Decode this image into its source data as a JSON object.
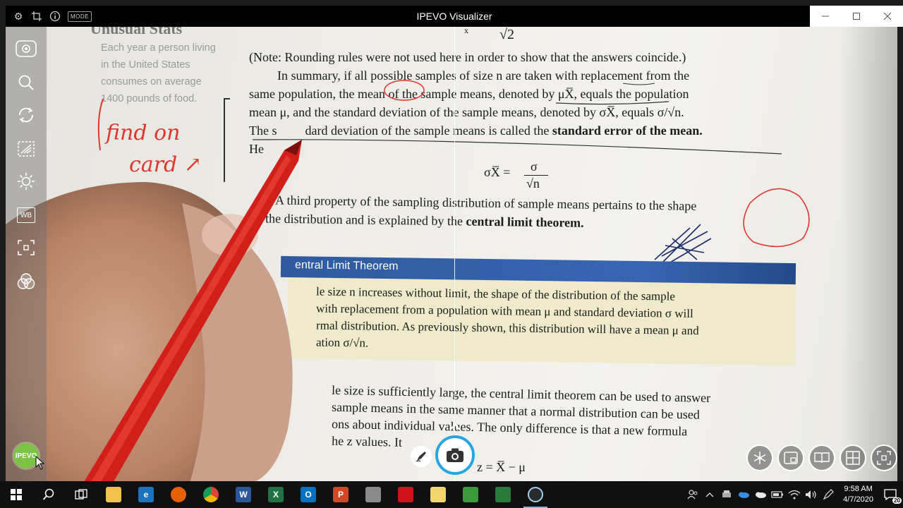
{
  "window": {
    "title": "IPEVO Visualizer",
    "mode_label": "MODE"
  },
  "camera": {
    "sidebar_heading": "Unusual Stats",
    "sidebar_note_lines": [
      "Each year a person living",
      "in the United States",
      "consumes on average",
      "1400 pounds of food."
    ],
    "handwriting_note": "find on card →",
    "paragraphs": {
      "note": "(Note: Rounding rules were not used here in order to show that the answers coincide.)",
      "summary_1": "In summary, if all possible samples of size n are taken with replacement from the",
      "summary_2": "same population, the mean of the sample means, denoted by μX̅, equals the population",
      "summary_3": "mean μ, and the standard deviation of the sample means, denoted by σX̅, equals σ/√n.",
      "summary_4a": "The s",
      "summary_4b": "dard deviation of the sample means is called the",
      "summary_4_bold": "standard error of the mean.",
      "summary_5": "He",
      "formula_top": "√2",
      "formula_std_error_left": "σX̅ =",
      "formula_std_error_num": "σ",
      "formula_std_error_den": "√n",
      "third_1": "A third property of the sampling distribution of sample means pertains to the shape",
      "third_2a": "the distribution and is explained by the",
      "third_2_bold": "central limit theorem.",
      "clt_header": "entral Limit Theorem",
      "clt_1": "le size n increases without limit, the shape of the distribution of the sample",
      "clt_2": "with replacement from a population with mean μ and standard deviation σ will",
      "clt_3": "rmal distribution. As previously shown, this distribution will have a mean μ and",
      "clt_4": "ation σ/√n.",
      "bottom_1": "le size is sufficiently large, the central limit theorem can be used to answer",
      "bottom_2": "sample means in the same manner that a normal distribution can be used",
      "bottom_3": "ons about individual values. The only difference is that a new formula",
      "bottom_4": "he z values. It",
      "bottom_formula": "z = X̅ − μ"
    }
  },
  "left_toolbar": {
    "items": [
      "record-icon",
      "zoom-icon",
      "rotate-icon",
      "mirror-icon",
      "brightness-icon",
      "whiteboard-icon",
      "autofocus-icon",
      "filter-icon"
    ],
    "wb_label": "WB",
    "logo_label": "IPEVO"
  },
  "bottom_controls": {
    "right_buttons": [
      "freeze-icon",
      "pip-icon",
      "book-icon",
      "grid-icon",
      "fullscreen-icon"
    ]
  },
  "taskbar": {
    "apps": [
      {
        "name": "file-explorer",
        "color": "#f0c14b",
        "label": ""
      },
      {
        "name": "edge",
        "color": "#1e73be",
        "label": "e"
      },
      {
        "name": "firefox",
        "color": "#e66000",
        "label": ""
      },
      {
        "name": "chrome",
        "color": "#4caf50",
        "label": ""
      },
      {
        "name": "word",
        "color": "#2b579a",
        "label": "W"
      },
      {
        "name": "excel",
        "color": "#217346",
        "label": "X"
      },
      {
        "name": "outlook",
        "color": "#0072c6",
        "label": "O"
      },
      {
        "name": "powerpoint",
        "color": "#d24726",
        "label": "P"
      },
      {
        "name": "paint",
        "color": "#8a8a8a",
        "label": ""
      },
      {
        "name": "acrobat",
        "color": "#d0121b",
        "label": ""
      },
      {
        "name": "sticky",
        "color": "#f2d56b",
        "label": ""
      },
      {
        "name": "camera-app",
        "color": "#3c9a3c",
        "label": ""
      },
      {
        "name": "excel-2",
        "color": "#2a7a3c",
        "label": ""
      },
      {
        "name": "ipevo-visualizer",
        "color": "#2a2a2a",
        "label": ""
      }
    ],
    "clock_time": "9:58 AM",
    "clock_date": "4/7/2020",
    "notification_count": "20"
  }
}
